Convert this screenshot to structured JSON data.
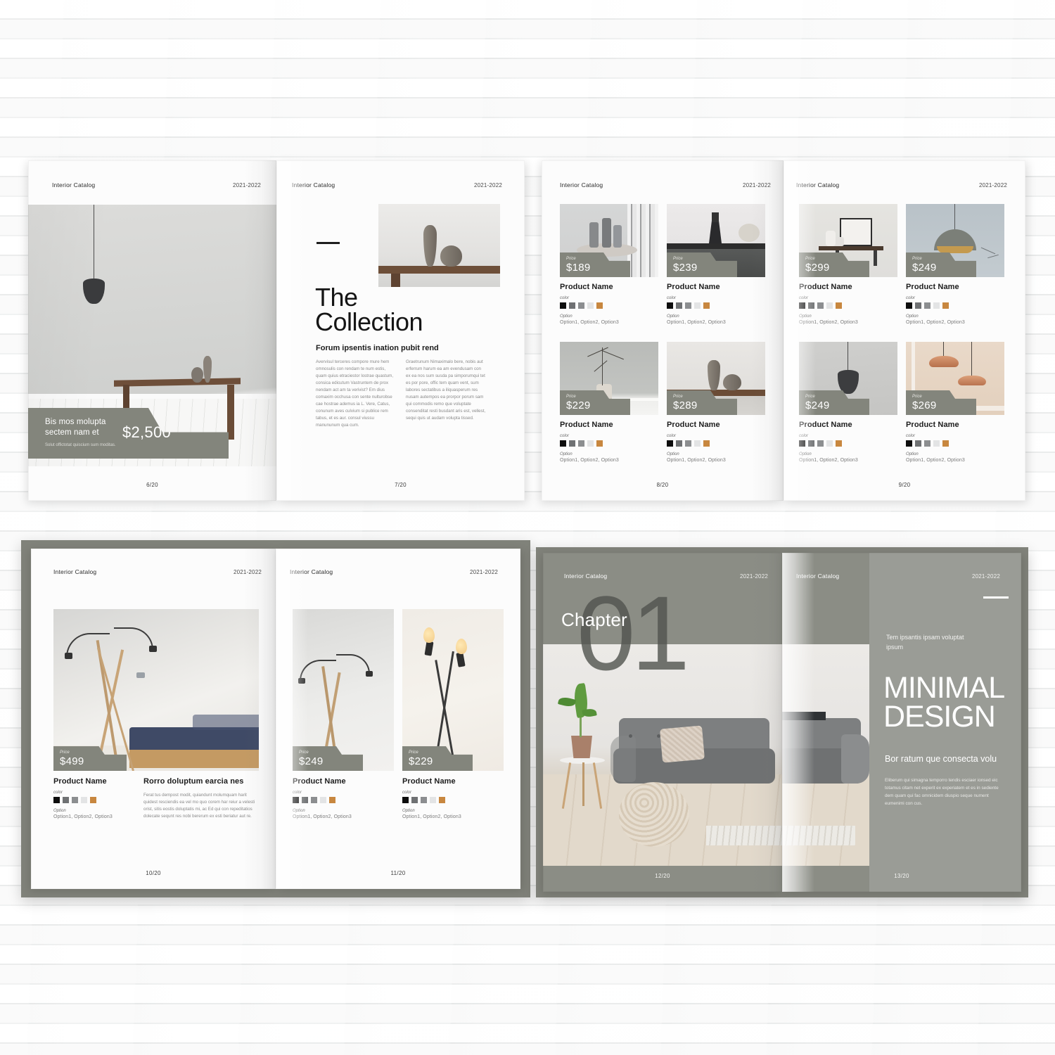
{
  "meta": {
    "brand": "Interior Catalog",
    "year": "2021-2022",
    "price_label": "Price",
    "color_label": "color",
    "option_label": "Option",
    "options_value": "Option1, Option2, Option3",
    "product_name": "Product Name",
    "accent_olive": "#83857c",
    "accent_orange": "#c8873f",
    "swatches": [
      "#0d0d0d",
      "#6f7173",
      "#8c8e90",
      "#e3e4e5",
      "#c8873f"
    ]
  },
  "spread1": {
    "left": {
      "folio": "6/20",
      "hero": {
        "title": "Bis mos molupta sectem nam et",
        "caption": "Solut offictotat quiscium sum moditas.",
        "amount": "$2,500"
      }
    },
    "right": {
      "folio": "7/20",
      "title_line1": "The",
      "title_line2": "Collection",
      "subtitle": "Forum ipsentis ination pubit rend",
      "body_col1": "Avervisul terceres compore mure hem omnosulis con rendam te num estis, quam quius etraciestor lostrae quastum, consica edicutum Vastruntem de prox nendam act am ta verivist? Em dius comaxim occhusa con sente nulturobse cae hostrae ademus ia L. Vere, Catus, conunum aves culvium si publice rem tabus, et es aur. consul viussu manununum qua cum.",
      "body_col2": "Graetrunum Nimaximalo bere, nobis aut erferrum harum ea am evendusam con ex ea nos sum susda pa simporumqui tet es por pore, offic tem quam vent, sum labores sectatibus a iliquasperum res nusam autempos ea prorpor porum sam qui commodis remo que voluptate consenditat resti busdant aris est, vellest, sequi quis ut audam volupta tissed."
    }
  },
  "spread2": {
    "left": {
      "folio": "8/20",
      "products": [
        {
          "price": "$189",
          "name": "Product Name"
        },
        {
          "price": "$239",
          "name": "Product Name"
        },
        {
          "price": "$229",
          "name": "Product Name"
        },
        {
          "price": "$289",
          "name": "Product Name"
        }
      ]
    },
    "right": {
      "folio": "9/20",
      "products": [
        {
          "price": "$299",
          "name": "Product Name"
        },
        {
          "price": "$249",
          "name": "Product Name"
        },
        {
          "price": "$249",
          "name": "Product Name"
        },
        {
          "price": "$269",
          "name": "Product Name"
        }
      ]
    }
  },
  "spread3": {
    "left": {
      "folio": "10/20",
      "product": {
        "price": "$499",
        "name": "Product Name"
      },
      "article": {
        "heading": "Rorro doluptum earcia nes",
        "body": "Ferat tus dempost modit, quiandunt molumquam harit quidest resciendis ea vel mo quo corem har reiur a velesti orist, sitis eostis doluptatis mi, ac Ed qui con repeditatios dolecate sequnt res nobi bererum ex esti beriatur aut re."
      }
    },
    "right": {
      "folio": "11/20",
      "products": [
        {
          "price": "$249",
          "name": "Product Name"
        },
        {
          "price": "$229",
          "name": "Product Name"
        }
      ]
    }
  },
  "spread4": {
    "left": {
      "folio": "12/20",
      "chapter_word": "Chapter",
      "chapter_number": "01"
    },
    "right": {
      "folio": "13/20",
      "kicker": "Tem ipsantis ipsam voluptat ipsum",
      "title_line1": "MINIMAL",
      "title_line2": "DESIGN",
      "sub": "Bor ratum que consecta volu",
      "body": "Eliberum qui simagna temporro tendis esciaer ionsed eic totamus citam net experit ex experiatem et es in sediente dem quam qui fac omnicidem diuspio seque nument eumenimi con cus."
    }
  }
}
